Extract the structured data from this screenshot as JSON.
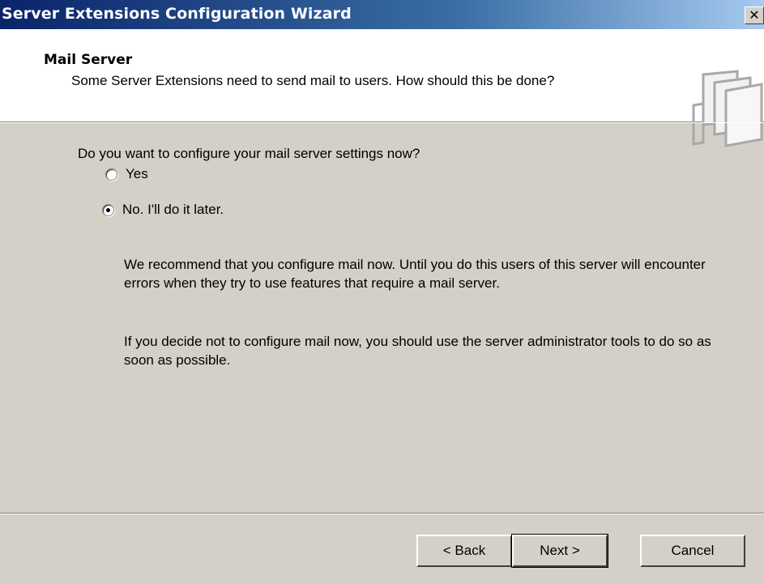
{
  "window": {
    "title": "Server Extensions Configuration Wizard",
    "close_glyph": "✕"
  },
  "header": {
    "title": "Mail Server",
    "subtitle": "Some Server Extensions need to send mail to users. How should this be done?",
    "icon": "wizard-pages-icon"
  },
  "main": {
    "question": "Do you want to configure your mail server settings now?",
    "options": [
      {
        "label": "Yes",
        "selected": false
      },
      {
        "label": "No. I'll do it later.",
        "selected": true
      }
    ],
    "paragraph1": "We recommend that you configure mail now. Until you do this users of this server will encounter errors when they try to use features that require a mail server.",
    "paragraph2": "If you decide not to configure mail now, you should use the server administrator tools to do so as soon as possible."
  },
  "buttons": {
    "back": "< Back",
    "next": "Next >",
    "cancel": "Cancel"
  }
}
